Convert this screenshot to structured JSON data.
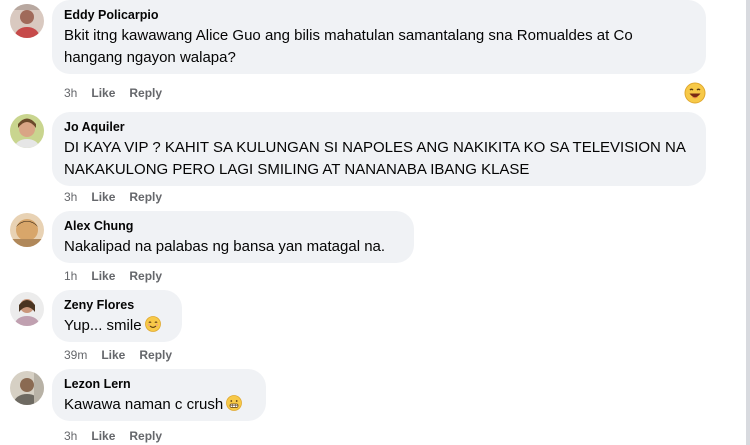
{
  "comments": [
    {
      "author": "Eddy Policarpio",
      "text": "Bkit itng kawawang Alice Guo ang bilis mahatulan samantalang sna Romualdes at Co\nhangang ngayon walapa?",
      "time": "3h",
      "like": "Like",
      "reply": "Reply",
      "reaction_icon": "laughing-emoji-icon"
    },
    {
      "author": "Jo Aquiler",
      "text": "DI KAYA VIP ? KAHIT SA KULUNGAN SI NAPOLES ANG NAKIKITA KO SA TELEVISION NA\nNAKAKULONG PERO LAGI SMILING AT NANANABA IBANG KLASE",
      "time": "3h",
      "like": "Like",
      "reply": "Reply"
    },
    {
      "author": "Alex Chung",
      "text": "Nakalipad na palabas ng bansa yan matagal na.",
      "time": "1h",
      "like": "Like",
      "reply": "Reply"
    },
    {
      "author": "Zeny Flores",
      "text": "Yup... smile",
      "emoji": "relieved-smile-emoji-icon",
      "time": "39m",
      "like": "Like",
      "reply": "Reply"
    },
    {
      "author": "Lezon Lern",
      "text": "Kawawa naman c crush",
      "emoji": "grimacing-emoji-icon",
      "time": "3h",
      "like": "Like",
      "reply": "Reply"
    }
  ],
  "colors": {
    "bubble": "#f0f2f5",
    "text": "#050505",
    "meta": "#65676b"
  }
}
